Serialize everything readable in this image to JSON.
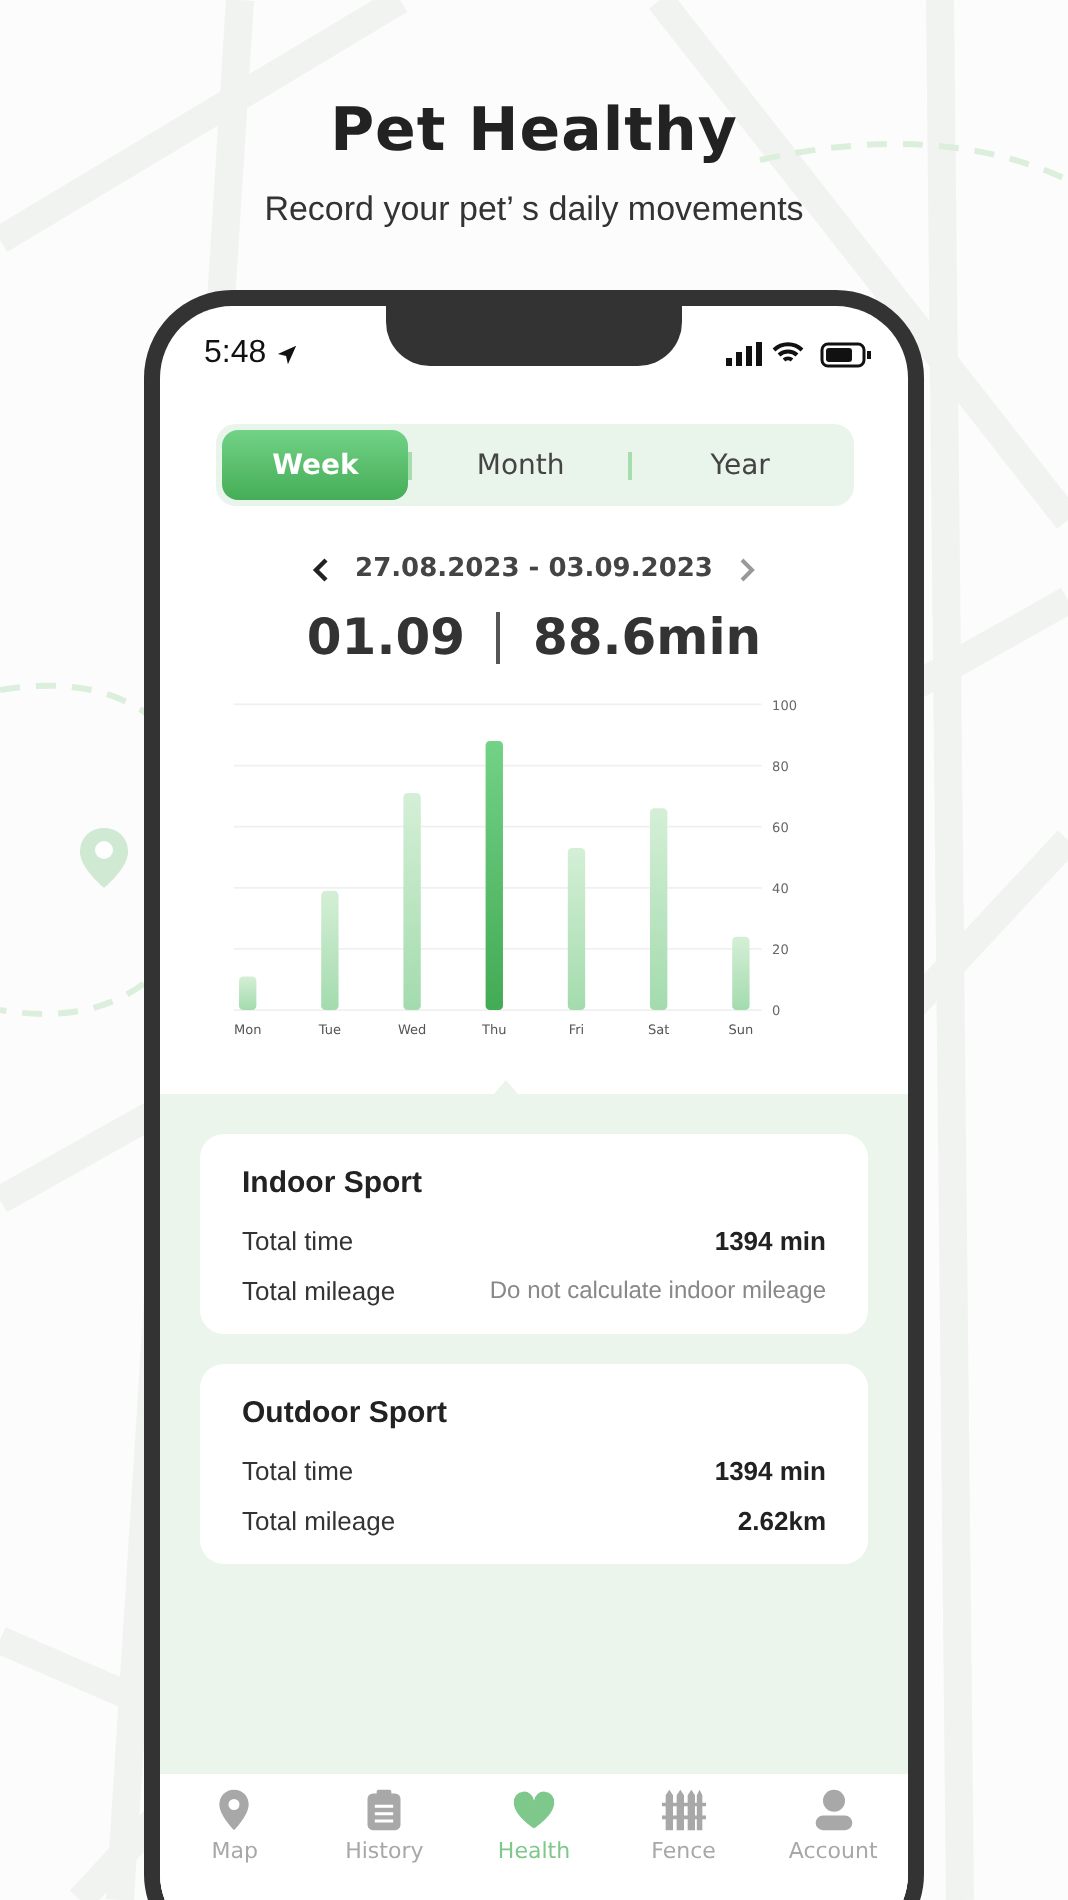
{
  "header": {
    "title": "Pet Healthy",
    "subtitle": "Record your pet’ s daily movements"
  },
  "status_bar": {
    "time": "5:48"
  },
  "tabs": [
    {
      "label": "Week",
      "selected": true
    },
    {
      "label": "Month",
      "selected": false
    },
    {
      "label": "Year",
      "selected": false
    }
  ],
  "date_range": "27.08.2023 - 03.09.2023",
  "summary": {
    "date": "01.09",
    "value": "88.6min"
  },
  "chart": {
    "selected_days": [
      false,
      false,
      false,
      true,
      false,
      false,
      false
    ],
    "chart_data": {
      "type": "bar",
      "categories": [
        "Mon",
        "Tue",
        "Wed",
        "Thu",
        "Fri",
        "Sat",
        "Sun"
      ],
      "values": [
        11,
        39,
        71,
        88,
        53,
        66,
        24
      ],
      "ylim": [
        0,
        100
      ],
      "grid": true,
      "yticks": [
        0,
        20,
        40,
        60,
        80,
        100
      ]
    }
  },
  "cards": [
    {
      "title": "Indoor Sport",
      "rows": [
        {
          "label": "Total time",
          "value": "1394 min",
          "emphasis": true
        },
        {
          "label": "Total mileage",
          "value": "Do not calculate indoor mileage",
          "emphasis": false
        }
      ]
    },
    {
      "title": "Outdoor Sport",
      "rows": [
        {
          "label": "Total time",
          "value": "1394 min",
          "emphasis": true
        },
        {
          "label": "Total mileage",
          "value": "2.62km",
          "emphasis": true
        }
      ]
    }
  ],
  "nav": [
    {
      "label": "Map",
      "kind": "map",
      "selected": false
    },
    {
      "label": "History",
      "kind": "history",
      "selected": false
    },
    {
      "label": "Health",
      "kind": "health",
      "selected": true
    },
    {
      "label": "Fence",
      "kind": "fence",
      "selected": false
    },
    {
      "label": "Account",
      "kind": "account",
      "selected": false
    }
  ]
}
